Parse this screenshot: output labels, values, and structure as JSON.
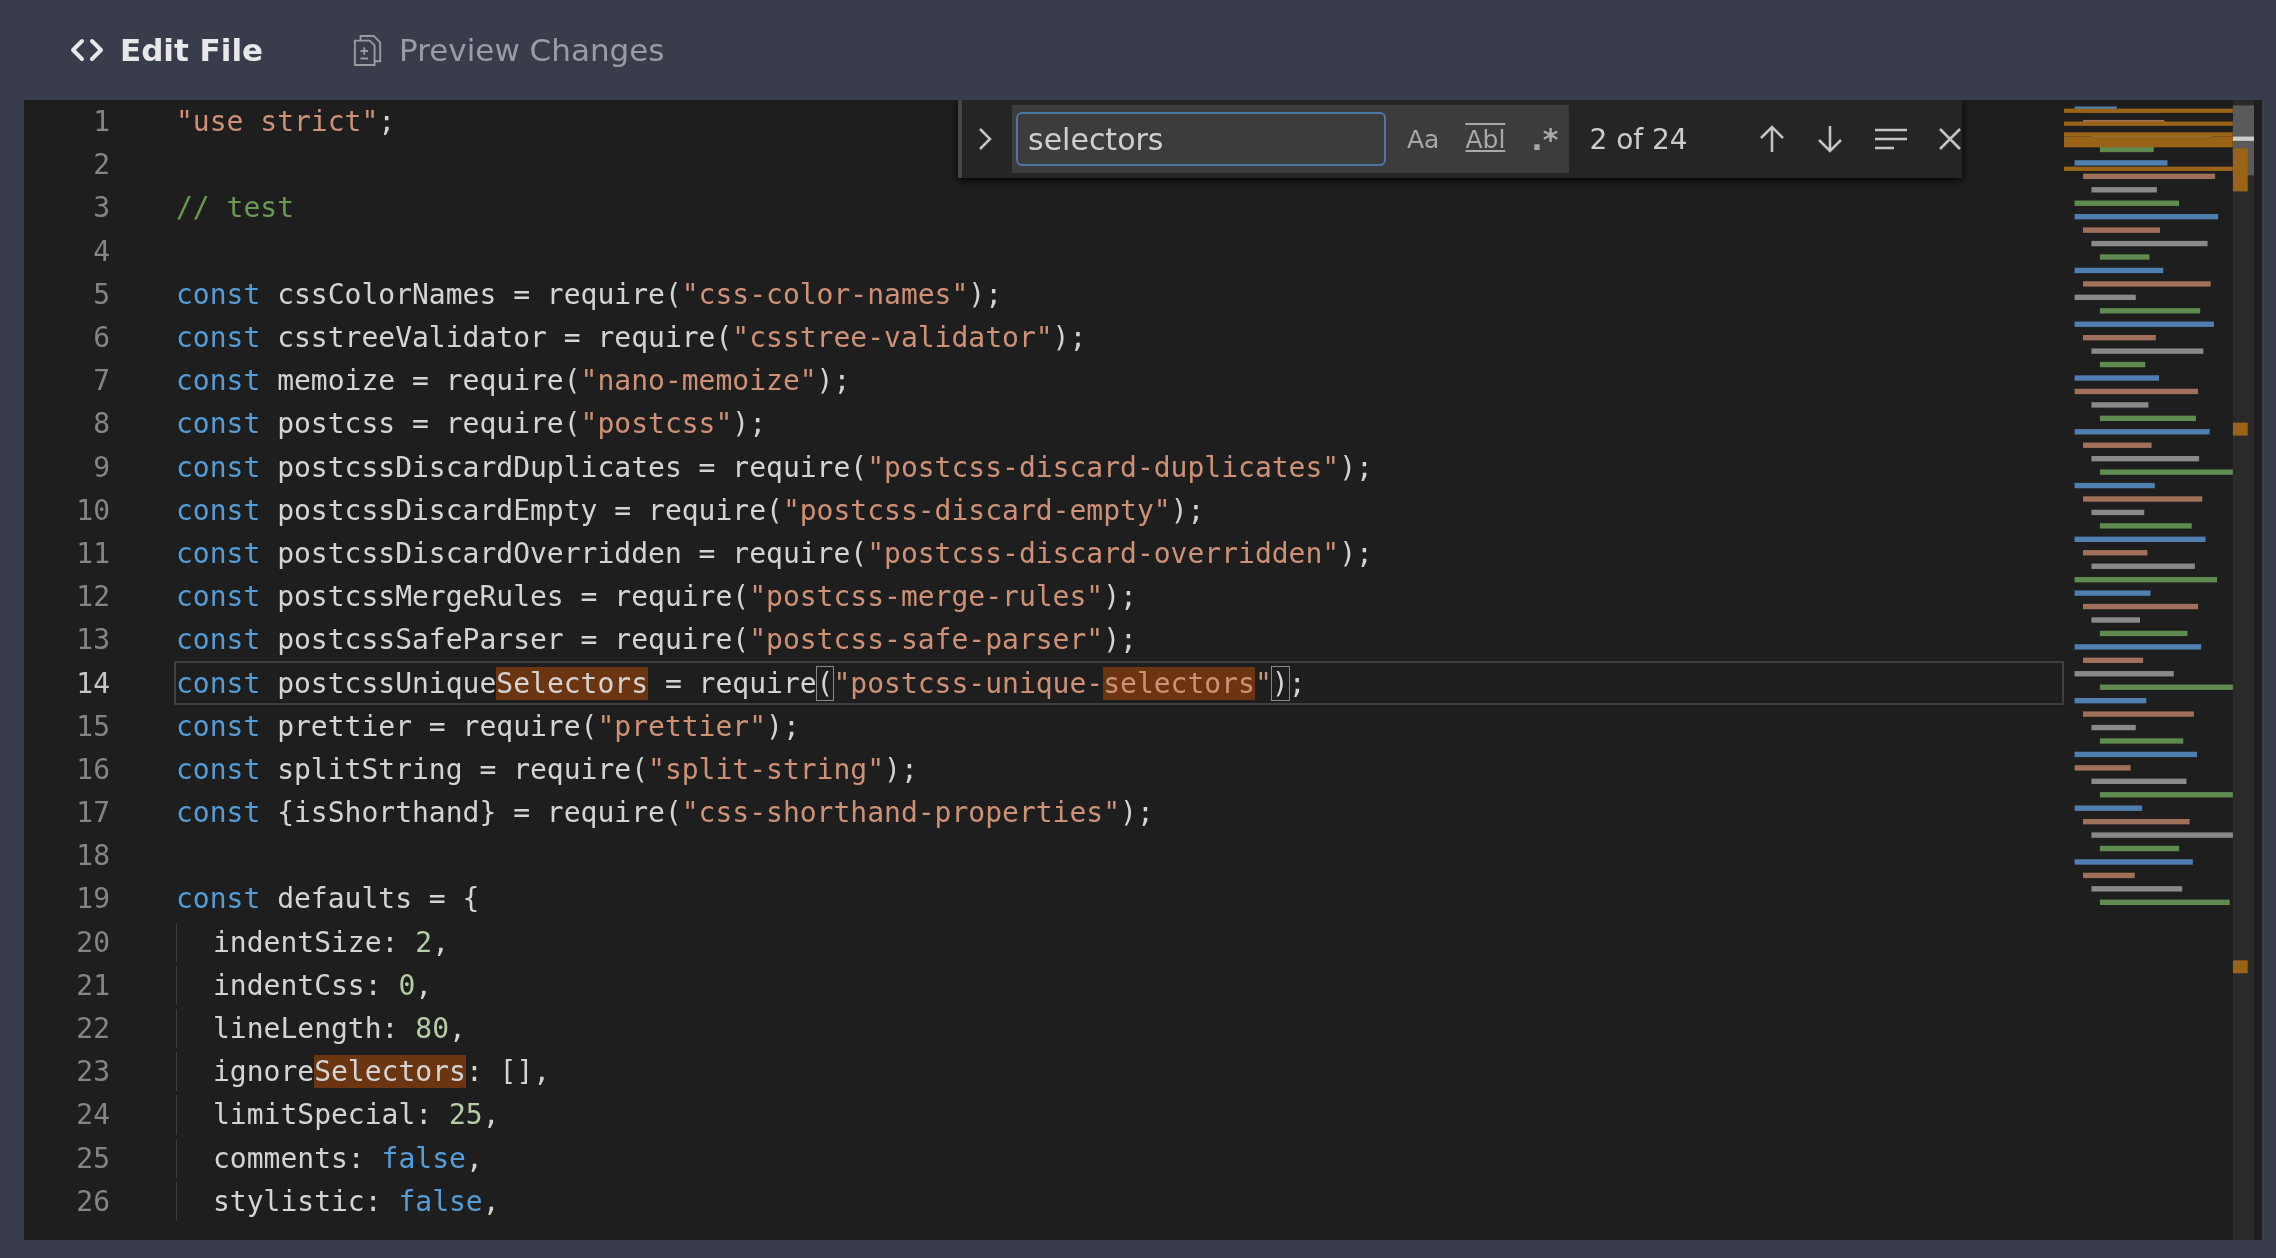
{
  "tabs": [
    {
      "label": "Edit File",
      "selected": true
    },
    {
      "label": "Preview Changes",
      "selected": false
    }
  ],
  "find": {
    "value": "selectors",
    "options": [
      {
        "label": "Aa",
        "kind": "case",
        "on": false
      },
      {
        "label": "Abl",
        "kind": "word",
        "on": false
      },
      {
        "label": ".*",
        "kind": "regex",
        "on": false
      }
    ],
    "count": "2 of 24"
  },
  "lines": [
    {
      "n": "1",
      "current": false,
      "tokens": [
        {
          "t": "\"use strict\"",
          "kind": "str"
        },
        {
          "t": ";",
          "kind": "plain"
        }
      ]
    },
    {
      "n": "2",
      "current": false
    },
    {
      "n": "3",
      "current": false,
      "tokens": [
        {
          "t": "// test",
          "kind": "cm"
        }
      ]
    },
    {
      "n": "4",
      "current": false
    },
    {
      "n": "5",
      "current": false,
      "tokens": [
        {
          "t": "const",
          "kind": "kw"
        },
        {
          "t": " cssColorNames = require(",
          "kind": "plain"
        },
        {
          "t": "\"css-color-names\"",
          "kind": "str"
        },
        {
          "t": ");",
          "kind": "plain"
        }
      ]
    },
    {
      "n": "6",
      "current": false,
      "tokens": [
        {
          "t": "const",
          "kind": "kw"
        },
        {
          "t": " csstreeValidator = require(",
          "kind": "plain"
        },
        {
          "t": "\"csstree-validator\"",
          "kind": "str"
        },
        {
          "t": ");",
          "kind": "plain"
        }
      ]
    },
    {
      "n": "7",
      "current": false,
      "tokens": [
        {
          "t": "const",
          "kind": "kw"
        },
        {
          "t": " memoize = require(",
          "kind": "plain"
        },
        {
          "t": "\"nano-memoize\"",
          "kind": "str"
        },
        {
          "t": ");",
          "kind": "plain"
        }
      ]
    },
    {
      "n": "8",
      "current": false,
      "tokens": [
        {
          "t": "const",
          "kind": "kw"
        },
        {
          "t": " postcss = require(",
          "kind": "plain"
        },
        {
          "t": "\"postcss\"",
          "kind": "str"
        },
        {
          "t": ");",
          "kind": "plain"
        }
      ]
    },
    {
      "n": "9",
      "current": false,
      "tokens": [
        {
          "t": "const",
          "kind": "kw"
        },
        {
          "t": " postcssDiscardDuplicates = require(",
          "kind": "plain"
        },
        {
          "t": "\"postcss-discard-duplicates\"",
          "kind": "str"
        },
        {
          "t": ");",
          "kind": "plain"
        }
      ]
    },
    {
      "n": "10",
      "current": false,
      "tokens": [
        {
          "t": "const",
          "kind": "kw"
        },
        {
          "t": " postcssDiscardEmpty = require(",
          "kind": "plain"
        },
        {
          "t": "\"postcss-discard-empty\"",
          "kind": "str"
        },
        {
          "t": ");",
          "kind": "plain"
        }
      ]
    },
    {
      "n": "11",
      "current": false,
      "tokens": [
        {
          "t": "const",
          "kind": "kw"
        },
        {
          "t": " postcssDiscardOverridden = require(",
          "kind": "plain"
        },
        {
          "t": "\"postcss-discard-overridden\"",
          "kind": "str"
        },
        {
          "t": ");",
          "kind": "plain"
        }
      ]
    },
    {
      "n": "12",
      "current": false,
      "tokens": [
        {
          "t": "const",
          "kind": "kw"
        },
        {
          "t": " postcssMergeRules = require(",
          "kind": "plain"
        },
        {
          "t": "\"postcss-merge-rules\"",
          "kind": "str"
        },
        {
          "t": ");",
          "kind": "plain"
        }
      ]
    },
    {
      "n": "13",
      "current": false,
      "tokens": [
        {
          "t": "const",
          "kind": "kw"
        },
        {
          "t": " postcssSafeParser = require(",
          "kind": "plain"
        },
        {
          "t": "\"postcss-safe-parser\"",
          "kind": "str"
        },
        {
          "t": ");",
          "kind": "plain"
        }
      ]
    },
    {
      "n": "14",
      "current": true,
      "tokens": [
        {
          "t": "const",
          "kind": "kw"
        },
        {
          "t": " postcssUnique",
          "kind": "plain"
        },
        {
          "t": "Selectors",
          "kind": "plain",
          "hl": true
        },
        {
          "t": " = require",
          "kind": "plain"
        },
        {
          "t": "(",
          "kind": "brk"
        },
        {
          "t": "\"postcss-unique-",
          "kind": "str"
        },
        {
          "t": "selectors",
          "kind": "str",
          "hl": true
        },
        {
          "t": "\"",
          "kind": "str"
        },
        {
          "t": ")",
          "kind": "brk"
        },
        {
          "t": ";",
          "kind": "plain"
        }
      ]
    },
    {
      "n": "15",
      "current": false,
      "tokens": [
        {
          "t": "const",
          "kind": "kw"
        },
        {
          "t": " prettier = require(",
          "kind": "plain"
        },
        {
          "t": "\"prettier\"",
          "kind": "str"
        },
        {
          "t": ");",
          "kind": "plain"
        }
      ]
    },
    {
      "n": "16",
      "current": false,
      "tokens": [
        {
          "t": "const",
          "kind": "kw"
        },
        {
          "t": " splitString = require(",
          "kind": "plain"
        },
        {
          "t": "\"split-string\"",
          "kind": "str"
        },
        {
          "t": ");",
          "kind": "plain"
        }
      ]
    },
    {
      "n": "17",
      "current": false,
      "tokens": [
        {
          "t": "const",
          "kind": "kw"
        },
        {
          "t": " {isShorthand} = require(",
          "kind": "plain"
        },
        {
          "t": "\"css-shorthand-properties\"",
          "kind": "str"
        },
        {
          "t": ");",
          "kind": "plain"
        }
      ]
    },
    {
      "n": "18",
      "current": false
    },
    {
      "n": "19",
      "current": false,
      "tokens": [
        {
          "t": "const",
          "kind": "kw"
        },
        {
          "t": " defaults = {",
          "kind": "plain"
        }
      ]
    },
    {
      "n": "20",
      "current": false,
      "indent": true,
      "tokens": [
        {
          "t": "indentSize: ",
          "kind": "plain"
        },
        {
          "t": "2",
          "kind": "num"
        },
        {
          "t": ",",
          "kind": "plain"
        }
      ]
    },
    {
      "n": "21",
      "current": false,
      "indent": true,
      "tokens": [
        {
          "t": "indentCss: ",
          "kind": "plain"
        },
        {
          "t": "0",
          "kind": "num"
        },
        {
          "t": ",",
          "kind": "plain"
        }
      ]
    },
    {
      "n": "22",
      "current": false,
      "indent": true,
      "tokens": [
        {
          "t": "lineLength: ",
          "kind": "plain"
        },
        {
          "t": "80",
          "kind": "num"
        },
        {
          "t": ",",
          "kind": "plain"
        }
      ]
    },
    {
      "n": "23",
      "current": false,
      "indent": true,
      "tokens": [
        {
          "t": "ignore",
          "kind": "plain"
        },
        {
          "t": "Selectors",
          "kind": "plain",
          "hl": true
        },
        {
          "t": ": [],",
          "kind": "plain"
        }
      ]
    },
    {
      "n": "24",
      "current": false,
      "indent": true,
      "tokens": [
        {
          "t": "limitSpecial: ",
          "kind": "plain"
        },
        {
          "t": "25",
          "kind": "num"
        },
        {
          "t": ",",
          "kind": "plain"
        }
      ]
    },
    {
      "n": "25",
      "current": false,
      "indent": true,
      "tokens": [
        {
          "t": "comments: ",
          "kind": "plain"
        },
        {
          "t": "false",
          "kind": "kw"
        },
        {
          "t": ",",
          "kind": "plain"
        }
      ]
    },
    {
      "n": "26",
      "current": false,
      "indent": true,
      "tokens": [
        {
          "t": "stylistic: ",
          "kind": "plain"
        },
        {
          "t": "false",
          "kind": "kw"
        },
        {
          "t": ",",
          "kind": "plain"
        }
      ]
    }
  ]
}
